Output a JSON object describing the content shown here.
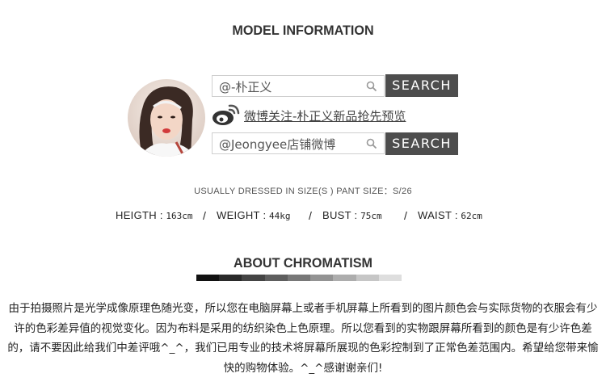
{
  "model_info": {
    "title": "MODEL INFORMATION",
    "search1": {
      "text": "@-朴正义",
      "button": "SEARCH"
    },
    "weibo_text": "微博关注-朴正义新品抢先预览",
    "search2": {
      "text": "@Jeongyee店铺微博",
      "button": "SEARCH"
    },
    "size_note": "USUALLY DRESSED IN SIZE(S )  PANT SIZE：S/26",
    "measurements": [
      {
        "label": "HEIGTH :",
        "value": "163cm"
      },
      {
        "label": "WEIGHT :",
        "value": "44kg"
      },
      {
        "label": "BUST :",
        "value": "75cm"
      },
      {
        "label": "WAIST :",
        "value": "62cm"
      }
    ],
    "separator": "/"
  },
  "chromatism": {
    "title": "ABOUT CHROMATISM",
    "scale_colors": [
      "#111111",
      "#2a2a2a",
      "#444444",
      "#5e5e5e",
      "#787878",
      "#939393",
      "#adadad",
      "#c6c6c6",
      "#dedede"
    ],
    "paragraph": "由于拍摄照片是光学成像原理色随光变，所以您在电脑屏幕上或者手机屏幕上所看到的图片颜色会与实际货物的衣服会有少许的色彩差异值的视觉变化。因为布料是采用的纺织染色上色原理。所以您看到的实物跟屏幕所看到的颜色是有少许色差的，请不要因此给我们中差评哦^_^，我们已用专业的技术将屏幕所展现的色彩控制到了正常色差范围内。希望给您带来愉快的购物体验。^_^感谢谢亲们!"
  },
  "colors": {
    "button_bg": "#4d4d4d",
    "text": "#333333",
    "weibo_red": "#e6162d",
    "weibo_yellow": "#f5a623"
  }
}
